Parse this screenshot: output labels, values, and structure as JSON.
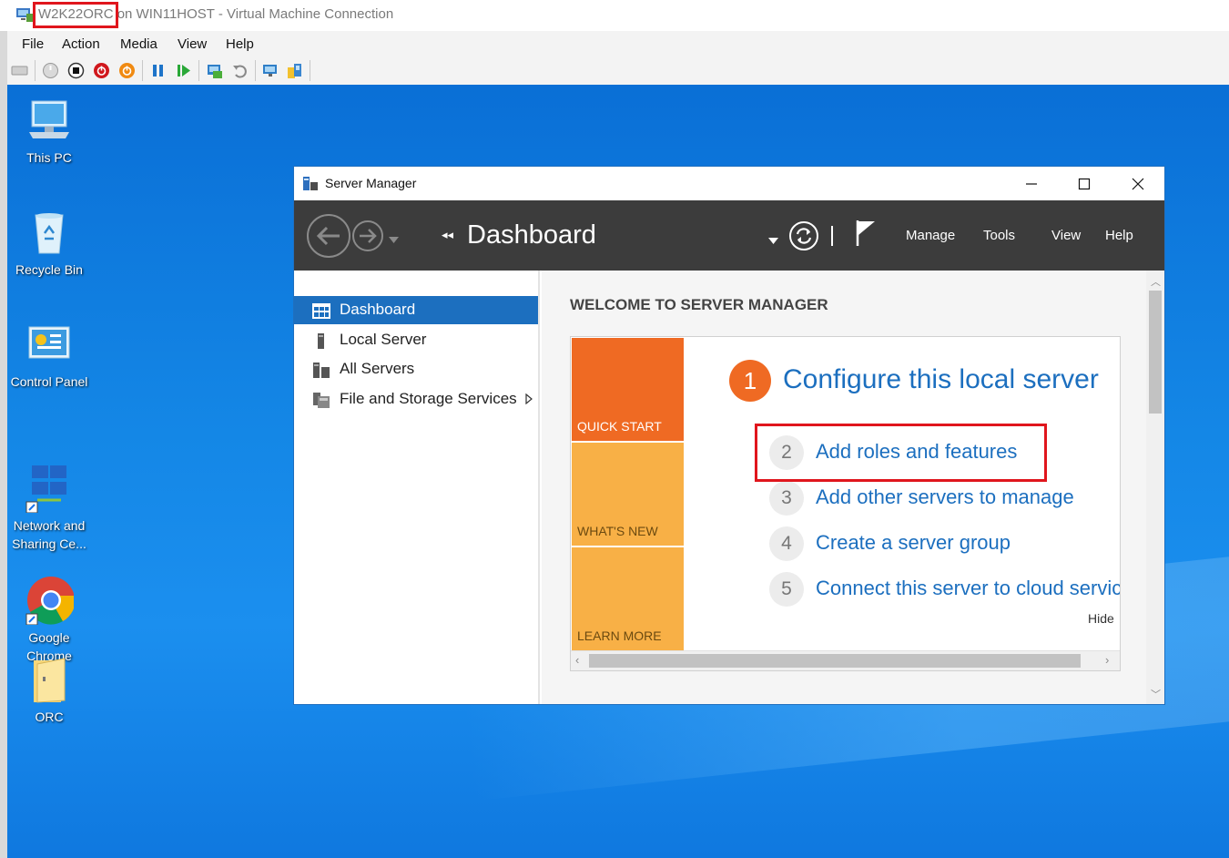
{
  "vm": {
    "vm_name": "W2K22ORC",
    "title_rest": " on WIN11HOST - Virtual Machine Connection",
    "menu": [
      "File",
      "Action",
      "Media",
      "View",
      "Help"
    ]
  },
  "desktop": {
    "icons": [
      {
        "label": "This PC"
      },
      {
        "label": "Recycle Bin"
      },
      {
        "label": "Control Panel"
      },
      {
        "label": "Network and\nSharing Ce..."
      },
      {
        "label": "Google\nChrome"
      },
      {
        "label": "ORC"
      }
    ]
  },
  "server_manager": {
    "title": "Server Manager",
    "header": {
      "breadcrumb": "Dashboard",
      "menu": [
        "Manage",
        "Tools",
        "View",
        "Help"
      ]
    },
    "sidebar": [
      {
        "label": "Dashboard",
        "active": true
      },
      {
        "label": "Local Server",
        "active": false
      },
      {
        "label": "All Servers",
        "active": false
      },
      {
        "label": "File and Storage Services",
        "active": false
      }
    ],
    "welcome_heading": "WELCOME TO SERVER MANAGER",
    "tiles": [
      "QUICK START",
      "WHAT'S NEW",
      "LEARN MORE"
    ],
    "step1": {
      "num": "1",
      "label": "Configure this local server"
    },
    "steps": [
      {
        "num": "2",
        "label": "Add roles and features"
      },
      {
        "num": "3",
        "label": "Add other servers to manage"
      },
      {
        "num": "4",
        "label": "Create a server group"
      },
      {
        "num": "5",
        "label": "Connect this server to cloud servic"
      }
    ],
    "hide_label": "Hide"
  },
  "colors": {
    "accent": "#1c6fbf",
    "orange": "#ef6a23",
    "light_orange": "#f8b046",
    "highlight": "#e0161d"
  }
}
